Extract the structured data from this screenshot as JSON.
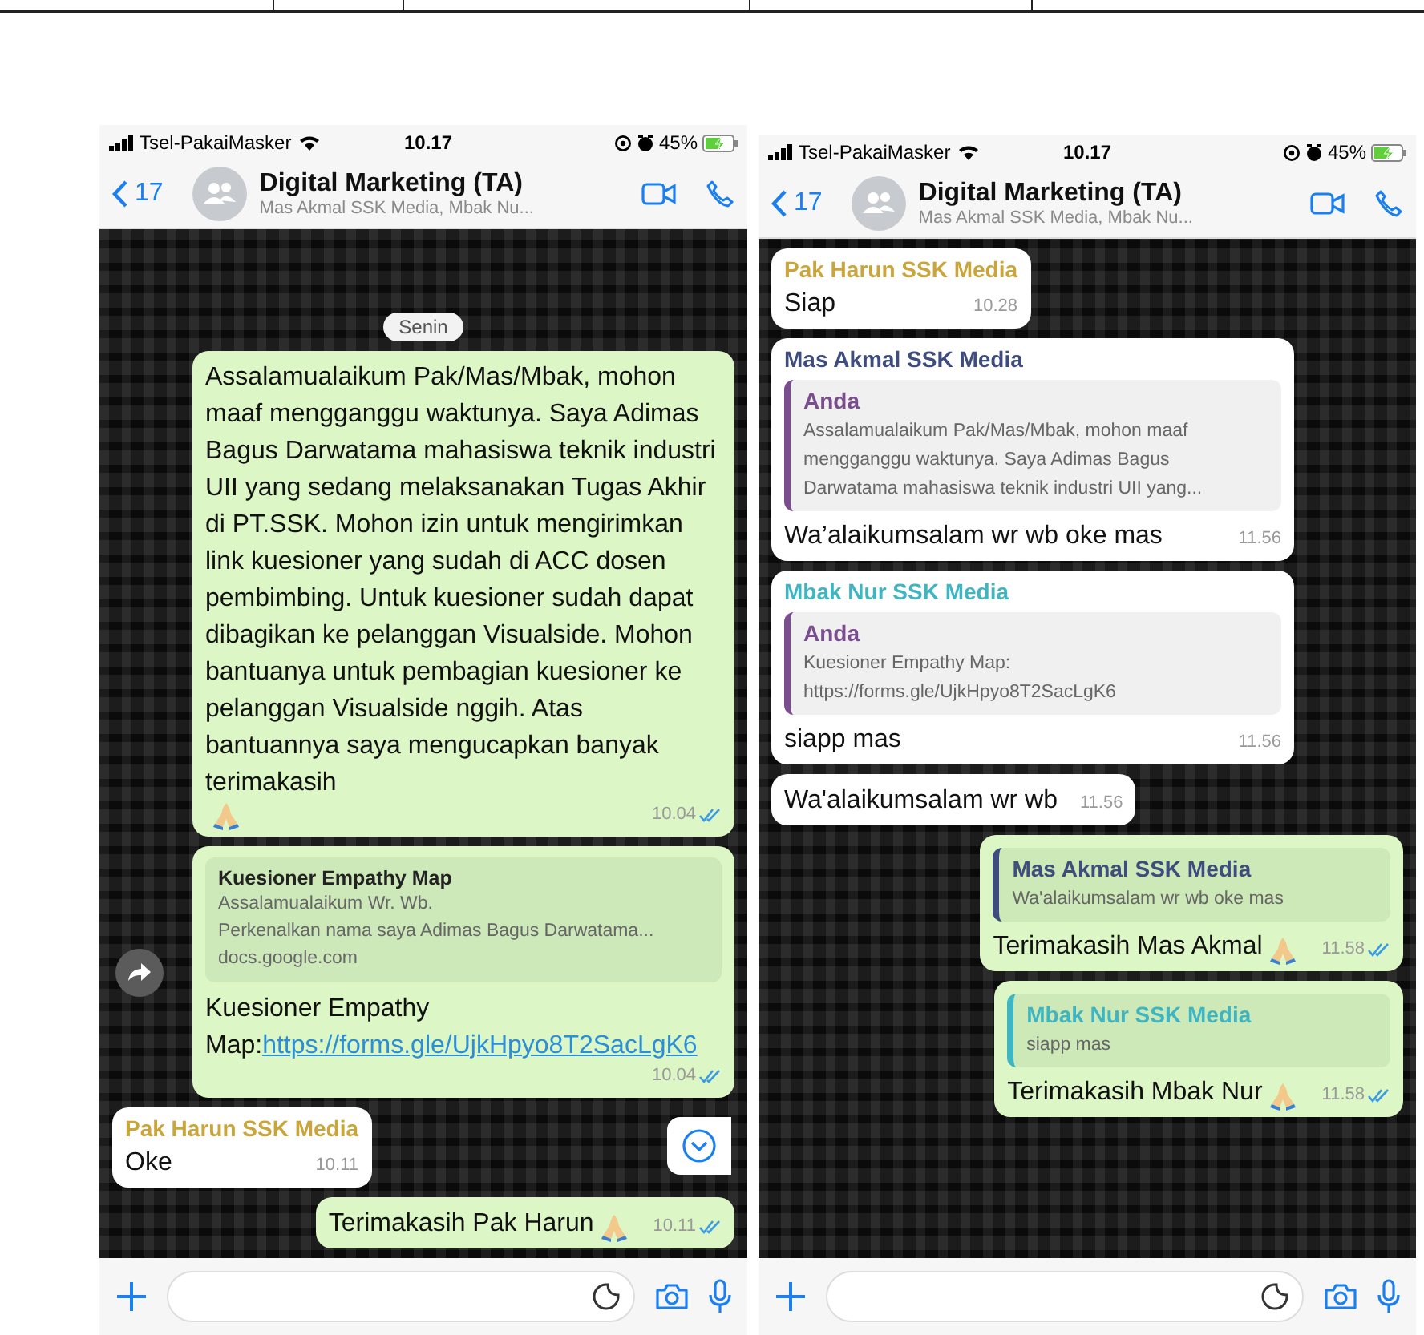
{
  "phones": [
    {
      "status": {
        "carrier": "Tsel-PakaiMasker",
        "time": "10.17",
        "battery": "45%"
      },
      "header": {
        "back_count": "17",
        "title": "Digital Marketing (TA)",
        "subtitle": "Mas Akmal SSK Media, Mbak Nu..."
      },
      "scroll_down_button": true,
      "messages": [
        {
          "kind": "date",
          "text": "Senin"
        },
        {
          "kind": "message",
          "outgoing": true,
          "body": "Assalamualaikum Pak/Mas/Mbak, mohon maaf mengganggu waktunya. Saya Adimas Bagus Darwatama mahasiswa teknik industri UII yang sedang melaksanakan Tugas Akhir di PT.SSK. Mohon izin untuk mengirimkan link kuesioner yang sudah di ACC dosen pembimbing. Untuk kuesioner sudah dapat dibagikan ke pelanggan Visualside. Mohon bantuanya untuk pembagian kuesioner ke pelanggan Visualside nggih. Atas bantuannya saya mengucapkan banyak terimakasih",
          "emoji": true,
          "time": "10.04",
          "read": true
        },
        {
          "kind": "message",
          "outgoing": true,
          "forward_button": true,
          "preview": {
            "title": "Kuesioner Empathy Map",
            "lines": [
              "Assalamualaikum Wr. Wb.",
              "Perkenalkan nama saya Adimas Bagus Darwatama..."
            ],
            "domain": "docs.google.com"
          },
          "body": "Kuesioner Empathy Map:",
          "link": "https://forms.gle/UjkHpyo8T2SacLgK6",
          "time": "10.04",
          "read": true
        },
        {
          "kind": "message",
          "outgoing": false,
          "sender": "Pak Harun SSK Media",
          "color": "#c9a53c",
          "body": "Oke",
          "time": "10.11"
        },
        {
          "kind": "message",
          "outgoing": true,
          "body": "Terimakasih Pak Harun",
          "emoji": true,
          "time": "10.11",
          "read": true
        }
      ]
    },
    {
      "status": {
        "carrier": "Tsel-PakaiMasker",
        "time": "10.17",
        "battery": "45%"
      },
      "header": {
        "back_count": "17",
        "title": "Digital Marketing (TA)",
        "subtitle": "Mas Akmal SSK Media, Mbak Nu..."
      },
      "messages": [
        {
          "kind": "message",
          "outgoing": false,
          "sender": "Pak Harun SSK Media",
          "color": "#c9a53c",
          "body": "Siap",
          "time": "10.28"
        },
        {
          "kind": "message",
          "outgoing": false,
          "sender": "Mas Akmal SSK Media",
          "color": "#3e4d7e",
          "quote": {
            "author": "Anda",
            "color": "#7a4d8e",
            "text": "Assalamualaikum Pak/Mas/Mbak, mohon maaf mengganggu waktunya. Saya Adimas Bagus Darwatama mahasiswa teknik industri UII yang..."
          },
          "body": "Wa’alaikumsalam wr wb oke mas",
          "time": "11.56"
        },
        {
          "kind": "message",
          "outgoing": false,
          "sender": "Mbak Nur SSK Media",
          "color": "#3fb5c2",
          "quote": {
            "author": "Anda",
            "color": "#7a4d8e",
            "text": "Kuesioner Empathy Map: https://forms.gle/UjkHpyo8T2SacLgK6"
          },
          "body": "siapp mas",
          "time": "11.56"
        },
        {
          "kind": "message",
          "outgoing": false,
          "body": "Wa'alaikumsalam wr wb",
          "time": "11.56"
        },
        {
          "kind": "message",
          "outgoing": true,
          "quote": {
            "author": "Mas Akmal SSK Media",
            "color": "#3e4d7e",
            "text": "Wa'alaikumsalam wr wb oke mas"
          },
          "body": "Terimakasih Mas Akmal",
          "emoji": true,
          "time": "11.58",
          "read": true
        },
        {
          "kind": "message",
          "outgoing": true,
          "quote": {
            "author": "Mbak Nur SSK Media",
            "color": "#3fb5c2",
            "text": "siapp mas"
          },
          "body": "Terimakasih Mbak Nur",
          "emoji": true,
          "time": "11.58",
          "read": true
        }
      ]
    }
  ]
}
